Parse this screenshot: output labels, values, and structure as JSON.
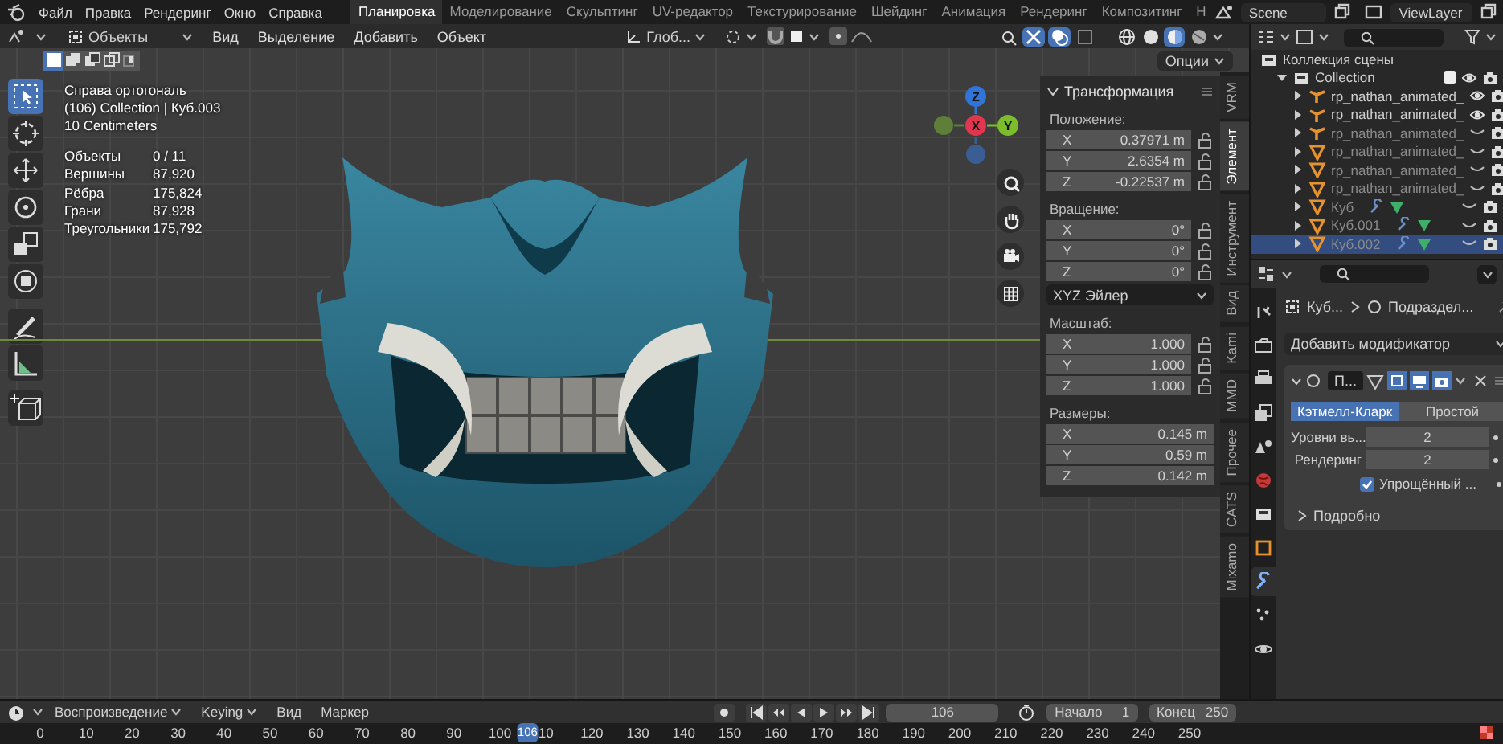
{
  "menu": [
    "Файл",
    "Правка",
    "Рендеринг",
    "Окно",
    "Справка"
  ],
  "workspaces": [
    {
      "label": "Планировка",
      "selected": true
    },
    {
      "label": "Моделирование",
      "selected": false
    },
    {
      "label": "Скульптинг",
      "selected": false
    },
    {
      "label": "UV-редактор",
      "selected": false
    },
    {
      "label": "Текстурирование",
      "selected": false
    },
    {
      "label": "Шейдинг",
      "selected": false
    },
    {
      "label": "Анимация",
      "selected": false
    },
    {
      "label": "Рендеринг",
      "selected": false
    },
    {
      "label": "Композитинг",
      "selected": false
    },
    {
      "label": "Н",
      "selected": false
    }
  ],
  "scene": "Scene",
  "view_layer": "ViewLayer",
  "viewport": {
    "mode": "Объекты",
    "menus": [
      "Вид",
      "Выделение",
      "Добавить",
      "Объект"
    ],
    "orientation": "Глоб...",
    "options": "Опции",
    "toggles": [
      {
        "kind": "visibility",
        "on": false
      },
      {
        "kind": "gizmo",
        "on": true
      },
      {
        "kind": "overlay",
        "on": true
      },
      {
        "kind": "xray",
        "on": false
      }
    ],
    "shading": [
      {
        "kind": "wireframe",
        "selected": false
      },
      {
        "kind": "solid",
        "selected": false
      },
      {
        "kind": "material",
        "selected": true
      },
      {
        "kind": "rendered",
        "selected": false
      }
    ],
    "select_modes": [
      {
        "kind": "set",
        "selected": true
      },
      {
        "kind": "extend",
        "selected": false
      },
      {
        "kind": "subtract",
        "selected": false
      },
      {
        "kind": "invert",
        "selected": false
      },
      {
        "kind": "intersect",
        "selected": false
      }
    ],
    "tools": [
      {
        "kind": "select",
        "selected": true
      },
      {
        "kind": "cursor",
        "selected": false
      },
      {
        "kind": "move",
        "selected": false
      },
      {
        "kind": "rotate",
        "selected": false
      },
      {
        "kind": "scale",
        "selected": false
      },
      {
        "kind": "transform",
        "selected": false
      },
      {
        "kind": "annotate",
        "selected": false
      },
      {
        "kind": "measure",
        "selected": false
      },
      {
        "kind": "add_cube",
        "selected": false
      }
    ],
    "overlay": {
      "lines": [
        "Справа ортогональ",
        "(106) Collection | Куб.003",
        "10 Centimeters"
      ],
      "stats": [
        {
          "label": "Объекты",
          "value": "0 / 11"
        },
        {
          "label": "Вершины",
          "value": "87,920"
        },
        {
          "label": "Рёбра",
          "value": "175,824"
        },
        {
          "label": "Грани",
          "value": "87,928"
        },
        {
          "label": "Треугольники",
          "value": "175,792"
        }
      ]
    },
    "gizmo": [
      {
        "kind": "pos",
        "label": "Z",
        "color": "#2f74d6"
      },
      {
        "kind": "neg",
        "color": "#3a5e93"
      },
      {
        "kind": "pos",
        "label": "X",
        "color": "#e0364f"
      },
      {
        "kind": "pos",
        "label": "Y",
        "color": "#7bbd2a"
      },
      {
        "kind": "neg",
        "color": "#5d7f38"
      }
    ],
    "sidebar": {
      "title": "Трансформация",
      "groups": [
        {
          "label": "Положение:",
          "locks": true,
          "fields": [
            {
              "axis": "X",
              "value": "0.37971 m"
            },
            {
              "axis": "Y",
              "value": "2.6354 m"
            },
            {
              "axis": "Z",
              "value": "-0.22537 m"
            }
          ]
        },
        {
          "label": "Вращение:",
          "locks": true,
          "fields": [
            {
              "axis": "X",
              "value": "0°"
            },
            {
              "axis": "Y",
              "value": "0°"
            },
            {
              "axis": "Z",
              "value": "0°"
            }
          ],
          "dropdown": "XYZ Эйлер"
        },
        {
          "label": "Масштаб:",
          "locks": true,
          "fields": [
            {
              "axis": "X",
              "value": "1.000"
            },
            {
              "axis": "Y",
              "value": "1.000"
            },
            {
              "axis": "Z",
              "value": "1.000"
            }
          ]
        },
        {
          "label": "Размеры:",
          "locks": false,
          "fields": [
            {
              "axis": "X",
              "value": "0.145 m"
            },
            {
              "axis": "Y",
              "value": "0.59 m"
            },
            {
              "axis": "Z",
              "value": "0.142 m"
            }
          ]
        }
      ]
    },
    "sidebar_tabs": [
      {
        "label": "VRM",
        "selected": false
      },
      {
        "label": "Элемент",
        "selected": true
      },
      {
        "label": "Инструмент",
        "selected": false
      },
      {
        "label": "Вид",
        "selected": false
      },
      {
        "label": "Kami",
        "selected": false
      },
      {
        "label": "MMD",
        "selected": false
      },
      {
        "label": "Прочее",
        "selected": false
      },
      {
        "label": "CATS",
        "selected": false
      },
      {
        "label": "Mixamo",
        "selected": false
      }
    ]
  },
  "outliner": {
    "title": "Коллекция сцены",
    "items": [
      {
        "label": "Collection",
        "kind": "collection",
        "expanded": true,
        "checked": true,
        "visible": true,
        "selected": false,
        "children": [
          {
            "label": "rp_nathan_animated_",
            "kind": "armature",
            "expanded": false,
            "visible": true,
            "selected": false
          },
          {
            "label": "rp_nathan_animated_",
            "kind": "armature",
            "expanded": false,
            "visible": true,
            "selected": false
          },
          {
            "label": "rp_nathan_animated_",
            "kind": "armature",
            "expanded": false,
            "visible": false,
            "selected": false
          },
          {
            "label": "rp_nathan_animated_",
            "kind": "mesh",
            "expanded": false,
            "visible": false,
            "selected": false
          },
          {
            "label": "rp_nathan_animated_",
            "kind": "mesh",
            "expanded": false,
            "visible": false,
            "selected": false
          },
          {
            "label": "rp_nathan_animated_",
            "kind": "mesh",
            "expanded": false,
            "visible": false,
            "selected": false
          },
          {
            "label": "Куб",
            "kind": "modified_mesh",
            "expanded": false,
            "visible": false,
            "selected": false
          },
          {
            "label": "Куб.001",
            "kind": "modified_mesh",
            "expanded": false,
            "visible": false,
            "selected": false
          },
          {
            "label": "Куб.002",
            "kind": "modified_mesh",
            "expanded": false,
            "visible": false,
            "selected": true
          }
        ]
      }
    ]
  },
  "properties": {
    "tabs": [
      {
        "kind": "tool",
        "selected": false
      },
      {
        "kind": "render",
        "selected": false
      },
      {
        "kind": "output",
        "selected": false
      },
      {
        "kind": "view_layer",
        "selected": false
      },
      {
        "kind": "scene",
        "selected": false
      },
      {
        "kind": "world",
        "selected": false
      },
      {
        "kind": "collection",
        "selected": false
      },
      {
        "kind": "object",
        "selected": false
      },
      {
        "kind": "modifier",
        "selected": true
      },
      {
        "kind": "particles",
        "selected": false
      },
      {
        "kind": "physics",
        "selected": false
      }
    ],
    "object": "Куб...",
    "modifier_name": "Подраздел...",
    "add_modifier": "Добавить модификатор",
    "modifier": {
      "name": "П...",
      "types": [
        {
          "label": "Кэтмелл-Кларк",
          "selected": true
        },
        {
          "label": "Простой",
          "selected": false
        }
      ],
      "fields": [
        {
          "label": "Уровни вь...",
          "value": "2"
        },
        {
          "label": "Рендеринг",
          "value": "2"
        }
      ],
      "simplified": {
        "label": "Упрощённый ...",
        "checked": true
      },
      "details": "Подробно"
    }
  },
  "timeline": {
    "menus": [
      {
        "label": "Воспроизведение",
        "dropdown": true
      },
      {
        "label": "Keying",
        "dropdown": true
      },
      {
        "label": "Вид",
        "dropdown": false
      },
      {
        "label": "Маркер",
        "dropdown": false
      }
    ],
    "current": "106",
    "start_label": "Начало",
    "start": "1",
    "end_label": "Конец",
    "end": "250",
    "ticks": [
      "0",
      "10",
      "20",
      "30",
      "40",
      "50",
      "60",
      "70",
      "80",
      "90",
      "100",
      "10",
      "120",
      "130",
      "140",
      "150",
      "160",
      "170",
      "180",
      "190",
      "200",
      "210",
      "220",
      "230",
      "240",
      "250"
    ],
    "marker": "106"
  }
}
